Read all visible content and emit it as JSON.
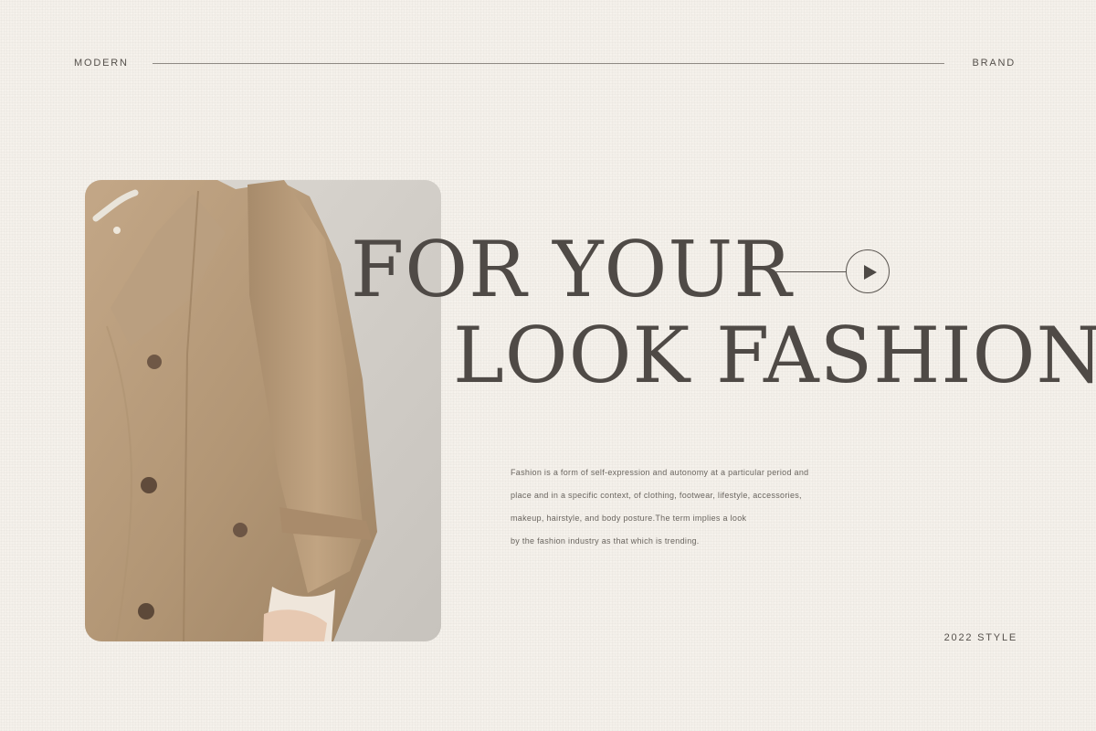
{
  "header": {
    "left_label": "MODERN",
    "right_label": "BRAND"
  },
  "hero": {
    "headline_line_1": "FOR YOUR",
    "headline_line_2": "LOOK FASHION",
    "play_icon": "play-circle-arrow-icon"
  },
  "description": {
    "lines": [
      "Fashion is a form of self-expression and autonomy at a particular period and",
      "place and in a specific context, of clothing, footwear, lifestyle, accessories,",
      "makeup, hairstyle, and body posture.The term implies a look",
      "by the fashion industry as that which is trending."
    ]
  },
  "footer": {
    "style_label": "2022 STYLE"
  },
  "colors": {
    "background": "#f4f0ea",
    "text": "#4f4a46",
    "coat": "#b89d7c",
    "photo_background": "#d7d3cd"
  }
}
